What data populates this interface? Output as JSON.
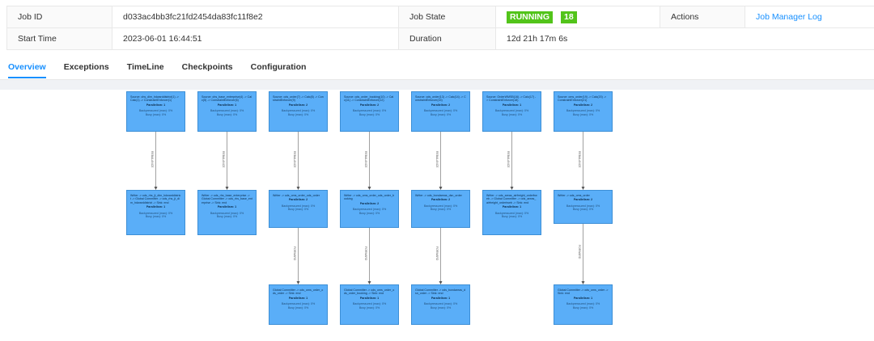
{
  "info": {
    "job_id_label": "Job ID",
    "job_id": "d033ac4bb3fc21fd2454da83fc11f8e2",
    "job_state_label": "Job State",
    "job_state": "RUNNING",
    "job_state_count": "18",
    "actions_label": "Actions",
    "actions_link": "Job Manager Log",
    "start_time_label": "Start Time",
    "start_time": "2023-06-01 16:44:51",
    "duration_label": "Duration",
    "duration": "12d 21h 17m 6s"
  },
  "colors": {
    "accent": "#1890ff",
    "running": "#52c41a",
    "node_fill": "#5aaef8",
    "node_border": "#3d8fd6"
  },
  "tabs": [
    {
      "label": "Overview",
      "active": true
    },
    {
      "label": "Exceptions",
      "active": false
    },
    {
      "label": "TimeLine",
      "active": false
    },
    {
      "label": "Checkpoints",
      "active": false
    },
    {
      "label": "Configuration",
      "active": false
    }
  ],
  "graph": {
    "columns": [
      {
        "nodes": [
          {
            "desc": "Source: ohs_dim_hdwarddistrict(1) -> Calc(1) -> ConstraintEnforcer(1)",
            "par": "Parallelism: 1",
            "s1": "Backpressured (max): 0%",
            "s2": "Busy (max): 0%"
          },
          {
            "desc": "Writer -> ods_rhs_jt_dim_hdwarddistrict -> Global Committer -> ods_rhs_jt_dim_hdwarddistrict -> Sink: end",
            "par": "Parallelism: 1",
            "s1": "Backpressured (max): 0%",
            "s2": "Busy (max): 0%"
          }
        ],
        "edge_labels": [
          "REBALANCE"
        ]
      },
      {
        "nodes": [
          {
            "desc": "Source: ohs_base_enterprise(4) -> Calc(5) -> ConstraintEnforcer(6)",
            "par": "Parallelism: 1",
            "s1": "Backpressured (max): 0%",
            "s2": "Busy (max): 0%"
          },
          {
            "desc": "Writer -> ods_rhs_base_enterprise -> Global Committer -> ods_rhs_base_enterprise -> Sink: end",
            "par": "Parallelism: 1",
            "s1": "Backpressured (max): 0%",
            "s2": "Busy (max): 0%"
          }
        ],
        "edge_labels": [
          "REBALANCE"
        ]
      },
      {
        "nodes": [
          {
            "desc": "Source: ods_order(7) -> Calc(8) -> ConstraintEnforcer(9)",
            "par": "Parallelism: 2",
            "s1": "Backpressured (max): 0%",
            "s2": "Busy (max): 0%"
          },
          {
            "desc": "Writer -> ods_oms_order_ods_order",
            "par": "Parallelism: 2",
            "s1": "Backpressured (max): 0%",
            "s2": "Busy (max): 0%"
          },
          {
            "desc": "Global Committer -> ods_oms_order_ods_order -> Sink: end",
            "par": "Parallelism: 1",
            "s1": "Backpressured (max): 0%",
            "s2": "Busy (max): 0%"
          }
        ],
        "edge_labels": [
          "REBALANCE",
          "FORWARD"
        ]
      },
      {
        "nodes": [
          {
            "desc": "Source: ods_order_booking(10) -> Calc(11) -> ConstraintEnforcer(12)",
            "par": "Parallelism: 2",
            "s1": "Backpressured (max): 0%",
            "s2": "Busy (max): 0%"
          },
          {
            "desc": "Writer -> ods_oms_order_ods_order_booking",
            "par": "Parallelism: 2",
            "s1": "Backpressured (max): 0%",
            "s2": "Busy (max): 0%"
          },
          {
            "desc": "Global Committer -> ods_oms_order_ods_order_booking -> Sink: end",
            "par": "Parallelism: 1",
            "s1": "Backpressured (max): 0%",
            "s2": "Busy (max): 0%"
          }
        ],
        "edge_labels": [
          "REBALANCE",
          "FORWARD"
        ]
      },
      {
        "nodes": [
          {
            "desc": "Source: ods_order(13) -> Calc(14) -> ConstraintEnforcer(15)",
            "par": "Parallelism: 2",
            "s1": "Backpressured (max): 0%",
            "s2": "Busy (max): 0%"
          },
          {
            "desc": "Writer -> ods_bondareas_dsn_order",
            "par": "Parallelism: 2",
            "s1": "Backpressured (max): 0%",
            "s2": "Busy (max): 0%"
          },
          {
            "desc": "Global Committer -> ods_bondareas_dsn_order -> Sink: end",
            "par": "Parallelism: 1",
            "s1": "Backpressured (max): 0%",
            "s2": "Busy (max): 0%"
          }
        ],
        "edge_labels": [
          "REBALANCE",
          "FORWARD"
        ]
      },
      {
        "nodes": [
          {
            "desc": "Source: OrderWMSB(16) -> Calc(17) -> ConstraintEnforcer(18)",
            "par": "Parallelism: 1",
            "s1": "Backpressured (max): 0%",
            "s2": "Busy (max): 0%"
          },
          {
            "desc": "Writer -> ods_areas_airfreight_orderfrweb -> Global Committer -> ods_areas_airfreight_ordertweb -> Sink: end",
            "par": "Parallelism: 1",
            "s1": "Backpressured (max): 0%",
            "s2": "Busy (max): 0%"
          }
        ],
        "edge_labels": [
          "REBALANCE"
        ]
      },
      {
        "nodes": [
          {
            "desc": "Source: oms_order(19) -> Calc(20) -> ConstraintEnforcer(21)",
            "par": "Parallelism: 2",
            "s1": "Backpressured (max): 0%",
            "s2": "Busy (max): 0%"
          },
          {
            "desc": "Writer -> ods_oms_order",
            "par": "Parallelism: 2",
            "s1": "Backpressured (max): 0%",
            "s2": "Busy (max): 0%"
          },
          {
            "desc": "Global Committer -> ods_oms_order -> Sink: end",
            "par": "Parallelism: 1",
            "s1": "Backpressured (max): 0%",
            "s2": "Busy (max): 0%"
          }
        ],
        "edge_labels": [
          "REBALANCE",
          "FORWARD"
        ]
      }
    ]
  }
}
